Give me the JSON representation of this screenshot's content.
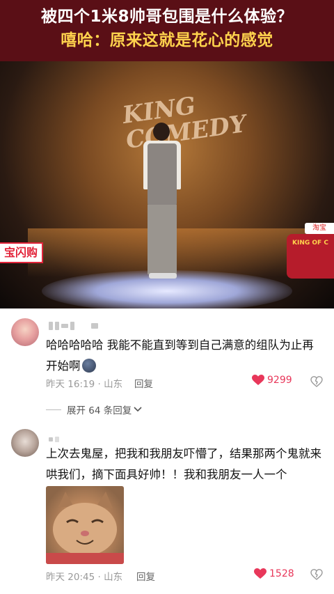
{
  "header": {
    "line1": "被四个1米8帅哥包围是什么体验？",
    "line2": "嘻哈：原来这就是花心的感觉"
  },
  "video": {
    "logo_text_line1": "KING",
    "logo_text_line2": "COMEDY",
    "left_badge": "宝闪购",
    "right_badge": "淘宝",
    "right_logo": "KING OF C"
  },
  "comments": [
    {
      "text": "哈哈哈哈哈 我能不能直到等到自己满意的组队为止再开始啊",
      "emoji": "emoji-icon",
      "time_location": "昨天 16:19 · 山东",
      "reply_label": "回复",
      "likes": "9299",
      "expand_label": "展开 64 条回复"
    },
    {
      "text": "上次去鬼屋，把我和我朋友吓懵了，结果那两个鬼就来哄我们，摘下面具好帅！！我和我朋友一人一个",
      "time_location": "昨天 20:45 · 山东",
      "reply_label": "回复",
      "likes": "1528"
    }
  ],
  "colors": {
    "header_bg": "#5a0f16",
    "header_line2": "#ffd34d",
    "like_red": "#e8375a"
  }
}
